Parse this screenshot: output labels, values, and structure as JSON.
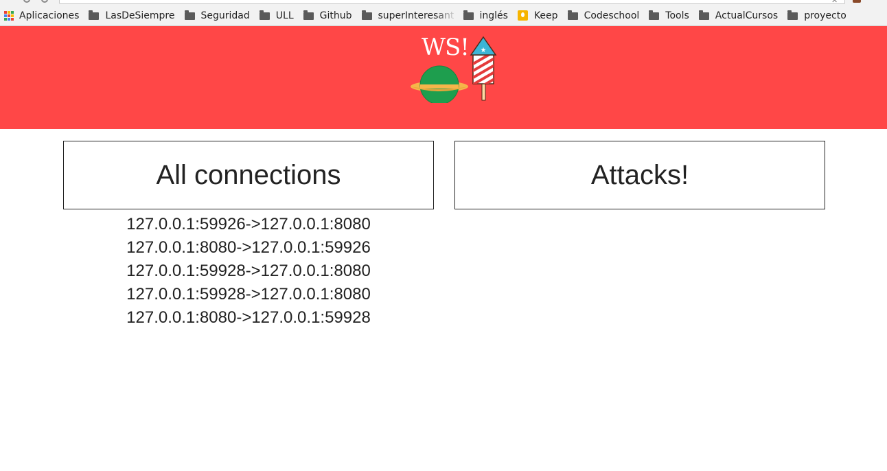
{
  "browser": {
    "bookmarks": [
      {
        "label": "Aplicaciones",
        "icon": "apps-grid-icon"
      },
      {
        "label": "LasDeSiempre",
        "icon": "folder-icon"
      },
      {
        "label": "Seguridad",
        "icon": "folder-icon"
      },
      {
        "label": "ULL",
        "icon": "folder-icon"
      },
      {
        "label": "Github",
        "icon": "folder-icon"
      },
      {
        "label": "superInteresante",
        "icon": "folder-icon"
      },
      {
        "label": "inglés",
        "icon": "folder-icon"
      },
      {
        "label": "Keep",
        "icon": "keep-icon"
      },
      {
        "label": "Codeschool",
        "icon": "folder-icon"
      },
      {
        "label": "Tools",
        "icon": "folder-icon"
      },
      {
        "label": "ActualCursos",
        "icon": "folder-icon"
      },
      {
        "label": "proyecto",
        "icon": "folder-icon"
      }
    ]
  },
  "header": {
    "logo_text": "WS!",
    "background_color": "#ff4747",
    "logo_icons": [
      "planet-icon",
      "rocket-icon"
    ]
  },
  "connections_panel": {
    "title": "All connections",
    "items": [
      "127.0.0.1:59926->127.0.0.1:8080",
      "127.0.0.1:8080->127.0.0.1:59926",
      "127.0.0.1:59928->127.0.0.1:8080",
      "127.0.0.1:59928->127.0.0.1:8080",
      "127.0.0.1:8080->127.0.0.1:59928"
    ]
  },
  "attacks_panel": {
    "title": "Attacks!"
  }
}
